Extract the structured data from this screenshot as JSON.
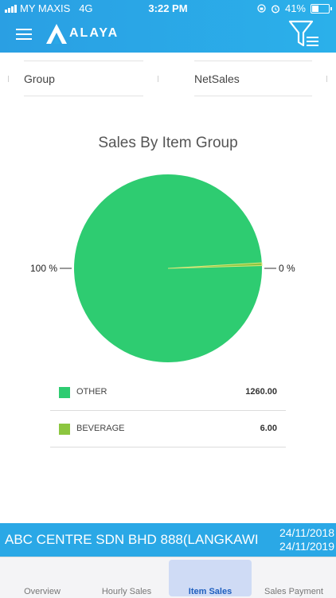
{
  "status_bar": {
    "carrier": "MY MAXIS",
    "network": "4G",
    "time": "3:22 PM",
    "battery": "41%",
    "battery_level": 0.41
  },
  "app": {
    "logo_text": "ALAYA",
    "icons": [
      "menu-icon",
      "logo-a-icon",
      "filter-icon"
    ],
    "accent": "#2aa8e6"
  },
  "table_header": {
    "columns": [
      "Group",
      "NetSales"
    ]
  },
  "chart_data": {
    "type": "pie",
    "title": "Sales By Item Group",
    "slices": [
      {
        "label": "OTHER",
        "value": 1260.0,
        "display": "1260.00",
        "percent_label": "100 %",
        "color": "#2ecc71"
      },
      {
        "label": "BEVERAGE",
        "value": 6.0,
        "display": "6.00",
        "percent_label": "0 %",
        "color": "#8cc63f"
      }
    ]
  },
  "company": {
    "name": "ABC CENTRE SDN BHD 888(LANGKAWI",
    "date_from": "24/11/2018",
    "date_to": "24/11/2019"
  },
  "tabs": [
    {
      "label": "Overview",
      "active": false
    },
    {
      "label": "Hourly Sales",
      "active": false
    },
    {
      "label": "Item Sales",
      "active": true
    },
    {
      "label": "Sales Payment",
      "active": false
    }
  ]
}
